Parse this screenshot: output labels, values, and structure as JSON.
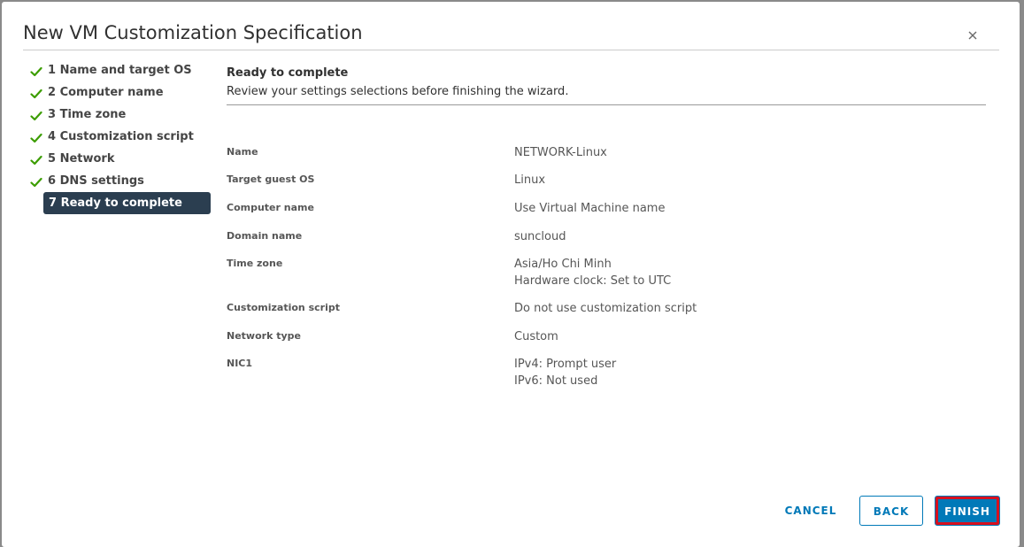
{
  "dialog": {
    "title": "New VM Customization Specification"
  },
  "steps": [
    {
      "label": "1 Name and target OS",
      "done": true
    },
    {
      "label": "2 Computer name",
      "done": true
    },
    {
      "label": "3 Time zone",
      "done": true
    },
    {
      "label": "4 Customization script",
      "done": true
    },
    {
      "label": "5 Network",
      "done": true
    },
    {
      "label": "6 DNS settings",
      "done": true
    },
    {
      "label": "7 Ready to complete",
      "active": true
    }
  ],
  "content": {
    "title": "Ready to complete",
    "description": "Review your settings selections before finishing the wizard."
  },
  "summary": [
    {
      "key": "Name",
      "values": [
        "NETWORK-Linux"
      ]
    },
    {
      "key": "Target guest OS",
      "values": [
        "Linux"
      ]
    },
    {
      "key": "Computer name",
      "values": [
        "Use Virtual Machine name"
      ]
    },
    {
      "key": "Domain name",
      "values": [
        "suncloud"
      ]
    },
    {
      "key": "Time zone",
      "values": [
        "Asia/Ho Chi Minh",
        "Hardware clock: Set to UTC"
      ]
    },
    {
      "key": "Customization script",
      "values": [
        "Do not use customization script"
      ]
    },
    {
      "key": "Network type",
      "values": [
        "Custom"
      ]
    },
    {
      "key": "NIC1",
      "values": [
        "IPv4: Prompt user",
        "IPv6: Not used"
      ]
    }
  ],
  "buttons": {
    "cancel": "CANCEL",
    "back": "BACK",
    "finish": "FINISH"
  },
  "colors": {
    "accent": "#0079b8",
    "check": "#3c9d00",
    "active_step_bg": "#2b3e50",
    "highlight": "#d8101e"
  }
}
